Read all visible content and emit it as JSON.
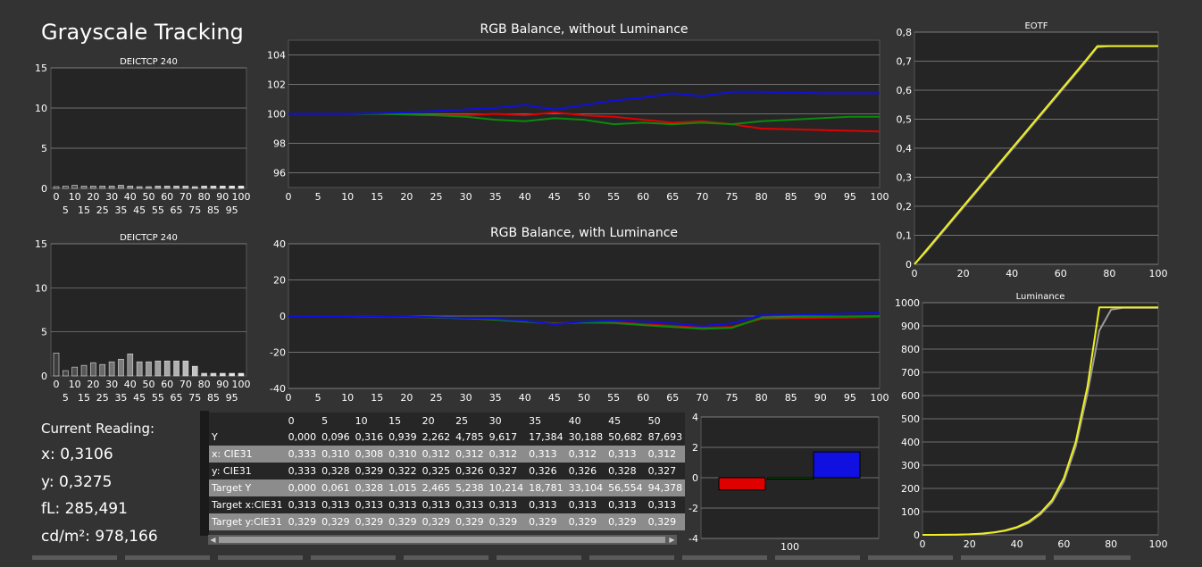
{
  "page_title": "Grayscale Tracking",
  "colors": {
    "red": "#e00000",
    "green": "#0a8a0a",
    "blue": "#1010e0",
    "yellow": "#f0f020",
    "gray": "#9a9a9a",
    "plot_bg": "#252525",
    "grid": "#8a8a8a"
  },
  "reading": {
    "header": "Current Reading:",
    "x": "x: 0,3106",
    "y": "y: 0,3275",
    "fl": "fL: 285,491",
    "cdm2": "cd/m²: 978,166"
  },
  "chart_data": [
    {
      "id": "de1",
      "type": "bar",
      "title": "DEICTCP 240",
      "ylim": [
        0,
        15
      ],
      "yticks": [
        "0",
        "5",
        "10",
        "15"
      ],
      "xticks_top": [
        "0",
        "10",
        "20",
        "30",
        "40",
        "50",
        "60",
        "70",
        "80",
        "90",
        "100"
      ],
      "xticks_bottom": [
        "5",
        "15",
        "25",
        "35",
        "45",
        "55",
        "65",
        "75",
        "85",
        "95"
      ],
      "x": [
        0,
        5,
        10,
        15,
        20,
        25,
        30,
        35,
        40,
        45,
        50,
        55,
        60,
        65,
        70,
        75,
        80,
        85,
        90,
        95,
        100
      ],
      "values": [
        0.2,
        0.3,
        0.4,
        0.3,
        0.3,
        0.3,
        0.3,
        0.4,
        0.3,
        0.2,
        0.2,
        0.3,
        0.3,
        0.3,
        0.3,
        0.2,
        0.3,
        0.3,
        0.3,
        0.3,
        0.3
      ]
    },
    {
      "id": "de2",
      "type": "bar",
      "title": "DEICTCP 240",
      "ylim": [
        0,
        15
      ],
      "yticks": [
        "0",
        "5",
        "10",
        "15"
      ],
      "xticks_top": [
        "0",
        "10",
        "20",
        "30",
        "40",
        "50",
        "60",
        "70",
        "80",
        "90",
        "100"
      ],
      "xticks_bottom": [
        "5",
        "15",
        "25",
        "35",
        "45",
        "55",
        "65",
        "75",
        "85",
        "95"
      ],
      "x": [
        0,
        5,
        10,
        15,
        20,
        25,
        30,
        35,
        40,
        45,
        50,
        55,
        60,
        65,
        70,
        75,
        80,
        85,
        90,
        95,
        100
      ],
      "values": [
        2.6,
        0.6,
        1.0,
        1.2,
        1.5,
        1.3,
        1.6,
        1.9,
        2.5,
        1.6,
        1.6,
        1.7,
        1.7,
        1.7,
        1.7,
        1.1,
        0.3,
        0.3,
        0.3,
        0.3,
        0.3
      ]
    },
    {
      "id": "rgb1",
      "type": "line",
      "title": "RGB Balance, without Luminance",
      "ylim": [
        95,
        105
      ],
      "yticks": [
        "96",
        "98",
        "100",
        "102",
        "104"
      ],
      "ytick_values": [
        96,
        98,
        100,
        102,
        104
      ],
      "xlim": [
        0,
        100
      ],
      "xticks": [
        "0",
        "5",
        "10",
        "15",
        "20",
        "25",
        "30",
        "35",
        "40",
        "45",
        "50",
        "55",
        "60",
        "65",
        "70",
        "75",
        "80",
        "85",
        "90",
        "95",
        "100"
      ],
      "x": [
        0,
        5,
        10,
        15,
        20,
        25,
        30,
        35,
        40,
        45,
        50,
        55,
        60,
        65,
        70,
        75,
        80,
        85,
        90,
        95,
        100
      ],
      "series": [
        {
          "color": "red",
          "values": [
            100,
            100,
            100,
            100,
            99.95,
            99.9,
            99.9,
            100,
            99.9,
            100.1,
            99.9,
            99.8,
            99.6,
            99.4,
            99.5,
            99.3,
            99.0,
            98.95,
            98.9,
            98.85,
            98.8
          ]
        },
        {
          "color": "green",
          "values": [
            100,
            100,
            100,
            100,
            99.95,
            99.9,
            99.8,
            99.6,
            99.5,
            99.7,
            99.6,
            99.3,
            99.4,
            99.3,
            99.4,
            99.3,
            99.5,
            99.6,
            99.7,
            99.8,
            99.8
          ]
        },
        {
          "color": "blue",
          "values": [
            100,
            100,
            100,
            100.05,
            100.1,
            100.2,
            100.3,
            100.4,
            100.6,
            100.3,
            100.6,
            100.9,
            101.1,
            101.4,
            101.2,
            101.5,
            101.5,
            101.45,
            101.4,
            101.4,
            101.4
          ]
        }
      ]
    },
    {
      "id": "rgb2",
      "type": "line",
      "title": "RGB Balance, with Luminance",
      "ylim": [
        -40,
        40
      ],
      "yticks": [
        "-40",
        "-20",
        "0",
        "20",
        "40"
      ],
      "ytick_values": [
        -40,
        -20,
        0,
        20,
        40
      ],
      "xlim": [
        0,
        100
      ],
      "xticks": [
        "0",
        "5",
        "10",
        "15",
        "20",
        "25",
        "30",
        "35",
        "40",
        "45",
        "50",
        "55",
        "60",
        "65",
        "70",
        "75",
        "80",
        "85",
        "90",
        "95",
        "100"
      ],
      "x": [
        0,
        5,
        10,
        15,
        20,
        25,
        30,
        35,
        40,
        45,
        50,
        55,
        60,
        65,
        70,
        75,
        80,
        85,
        90,
        95,
        100
      ],
      "series": [
        {
          "color": "red",
          "values": [
            0,
            0,
            0,
            -0.2,
            -0.4,
            -0.8,
            -1.2,
            -2,
            -3,
            -4,
            -3.5,
            -3.5,
            -4.5,
            -5.5,
            -6.5,
            -6,
            -1.5,
            -1.2,
            -1,
            -0.8,
            -0.5
          ]
        },
        {
          "color": "green",
          "values": [
            0,
            0,
            0,
            -0.2,
            -0.4,
            -0.8,
            -1.2,
            -2,
            -3,
            -4.2,
            -3.5,
            -3.8,
            -5,
            -6,
            -7,
            -6.5,
            -1,
            -0.6,
            -0.4,
            -0.2,
            0
          ]
        },
        {
          "color": "blue",
          "values": [
            0,
            0,
            0,
            -0.1,
            -0.3,
            -0.6,
            -1,
            -1.5,
            -2.5,
            -4.5,
            -3,
            -2.5,
            -3,
            -4,
            -5.5,
            -4,
            0.5,
            0.7,
            1,
            1.5,
            1.8
          ]
        }
      ]
    },
    {
      "id": "eotf",
      "type": "line",
      "title": "EOTF",
      "ylim": [
        0,
        0.8
      ],
      "yticks": [
        "0",
        "0,1",
        "0,2",
        "0,3",
        "0,4",
        "0,5",
        "0,6",
        "0,7",
        "0,8"
      ],
      "ytick_values": [
        0,
        0.1,
        0.2,
        0.3,
        0.4,
        0.5,
        0.6,
        0.7,
        0.8
      ],
      "xlim": [
        0,
        100
      ],
      "xticks": [
        "0",
        "20",
        "40",
        "60",
        "80",
        "100"
      ],
      "xtick_values": [
        0,
        20,
        40,
        60,
        80,
        100
      ],
      "x": [
        0,
        5,
        10,
        15,
        20,
        25,
        30,
        35,
        40,
        45,
        50,
        55,
        60,
        65,
        70,
        75,
        80,
        85,
        90,
        95,
        100
      ],
      "series": [
        {
          "color": "gray",
          "values": [
            0,
            0.045,
            0.095,
            0.145,
            0.195,
            0.245,
            0.295,
            0.345,
            0.395,
            0.445,
            0.495,
            0.545,
            0.595,
            0.645,
            0.695,
            0.748,
            0.752,
            0.752,
            0.752,
            0.752,
            0.752
          ]
        },
        {
          "color": "yellow",
          "values": [
            0,
            0.05,
            0.1,
            0.15,
            0.2,
            0.25,
            0.3,
            0.35,
            0.4,
            0.45,
            0.5,
            0.55,
            0.6,
            0.65,
            0.7,
            0.752,
            0.752,
            0.752,
            0.752,
            0.752,
            0.752
          ]
        }
      ]
    },
    {
      "id": "lum",
      "type": "line",
      "title": "Luminance",
      "ylim": [
        0,
        1000
      ],
      "yticks": [
        "0",
        "100",
        "200",
        "300",
        "400",
        "500",
        "600",
        "700",
        "800",
        "900",
        "1000"
      ],
      "ytick_values": [
        0,
        100,
        200,
        300,
        400,
        500,
        600,
        700,
        800,
        900,
        1000
      ],
      "xlim": [
        0,
        100
      ],
      "xticks": [
        "0",
        "20",
        "40",
        "60",
        "80",
        "100"
      ],
      "xtick_values": [
        0,
        20,
        40,
        60,
        80,
        100
      ],
      "x": [
        0,
        5,
        10,
        15,
        20,
        25,
        30,
        35,
        40,
        45,
        50,
        55,
        60,
        65,
        70,
        75,
        80,
        85,
        90,
        95,
        100
      ],
      "series": [
        {
          "color": "gray",
          "values": [
            0,
            0.1,
            0.3,
            0.9,
            2.3,
            4.8,
            9.6,
            17.4,
            30.2,
            50.7,
            87.7,
            140,
            230,
            380,
            610,
            880,
            970,
            978,
            978,
            978,
            978
          ]
        },
        {
          "color": "yellow",
          "values": [
            0,
            0.06,
            0.33,
            1.0,
            2.5,
            5.2,
            10.2,
            18.8,
            33.1,
            56.6,
            94.4,
            150,
            245,
            400,
            640,
            980,
            980,
            980,
            980,
            980,
            980
          ]
        }
      ]
    },
    {
      "id": "current",
      "type": "bar",
      "title": "",
      "ylim": [
        -4,
        4
      ],
      "yticks": [
        "-4",
        "-2",
        "0",
        "2",
        "4"
      ],
      "ytick_values": [
        -4,
        -2,
        0,
        2,
        4
      ],
      "xlabel": "100",
      "series": [
        {
          "color": "red",
          "value": -0.8
        },
        {
          "color": "green",
          "value": -0.05
        },
        {
          "color": "blue",
          "value": 1.7
        }
      ]
    }
  ],
  "table": {
    "columns": [
      "0",
      "5",
      "10",
      "15",
      "20",
      "25",
      "30",
      "35",
      "40",
      "45",
      "50"
    ],
    "rows": [
      {
        "label": "Y",
        "values": [
          "0,000",
          "0,096",
          "0,316",
          "0,939",
          "2,262",
          "4,785",
          "9,617",
          "17,384",
          "30,188",
          "50,682",
          "87,693"
        ]
      },
      {
        "label": "x: CIE31",
        "values": [
          "0,333",
          "0,310",
          "0,308",
          "0,310",
          "0,312",
          "0,312",
          "0,312",
          "0,313",
          "0,312",
          "0,313",
          "0,312"
        ]
      },
      {
        "label": "y: CIE31",
        "values": [
          "0,333",
          "0,328",
          "0,329",
          "0,322",
          "0,325",
          "0,326",
          "0,327",
          "0,326",
          "0,326",
          "0,328",
          "0,327"
        ]
      },
      {
        "label": "Target Y",
        "values": [
          "0,000",
          "0,061",
          "0,328",
          "1,015",
          "2,465",
          "5,238",
          "10,214",
          "18,781",
          "33,104",
          "56,554",
          "94,378"
        ]
      },
      {
        "label": "Target x:CIE31",
        "values": [
          "0,313",
          "0,313",
          "0,313",
          "0,313",
          "0,313",
          "0,313",
          "0,313",
          "0,313",
          "0,313",
          "0,313",
          "0,313"
        ]
      },
      {
        "label": "Target y:CIE31",
        "values": [
          "0,329",
          "0,329",
          "0,329",
          "0,329",
          "0,329",
          "0,329",
          "0,329",
          "0,329",
          "0,329",
          "0,329",
          "0,329"
        ]
      }
    ]
  },
  "scroll": {
    "left_arrow": "◀",
    "right_arrow": "▶"
  }
}
